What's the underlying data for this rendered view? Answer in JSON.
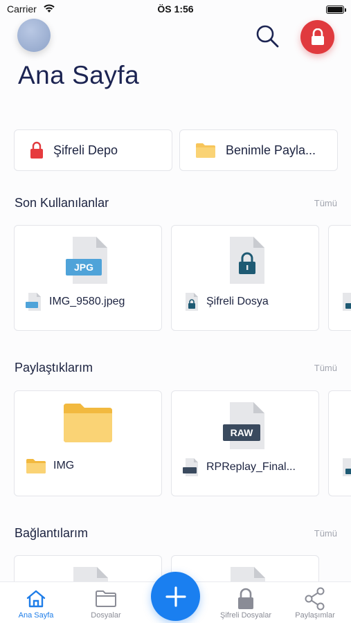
{
  "status_bar": {
    "carrier": "Carrier",
    "time": "ÖS 1:56"
  },
  "header": {
    "title": "Ana Sayfa"
  },
  "quick_access": [
    {
      "label": "Şifreli Depo",
      "icon": "red-lock-icon"
    },
    {
      "label": "Benimle Payla...",
      "icon": "yellow-folder-icon"
    }
  ],
  "sections": {
    "recent": {
      "title": "Son Kullanılanlar",
      "all_label": "Tümü",
      "items": [
        {
          "name": "IMG_9580.jpeg",
          "type_badge": "JPG",
          "icon": "jpg-file-icon"
        },
        {
          "name": "Şifreli Dosya",
          "icon": "locked-file-icon"
        }
      ]
    },
    "shared": {
      "title": "Paylaştıklarım",
      "all_label": "Tümü",
      "items": [
        {
          "name": "IMG",
          "icon": "folder-icon"
        },
        {
          "name": "RPReplay_Final...",
          "type_badge": "RAW",
          "icon": "raw-file-icon"
        }
      ]
    },
    "links": {
      "title": "Bağlantılarım",
      "all_label": "Tümü"
    }
  },
  "tab_bar": {
    "items": [
      {
        "label": "Ana Sayfa",
        "icon": "home-icon",
        "active": true
      },
      {
        "label": "Dosyalar",
        "icon": "folder-outline-icon",
        "active": false
      },
      {
        "label": "Şifreli Dosyalar",
        "icon": "lock-icon",
        "active": false
      },
      {
        "label": "Paylaşımlar",
        "icon": "share-icon",
        "active": false
      }
    ],
    "fab_icon": "plus-icon"
  },
  "colors": {
    "accent_blue": "#1a7ff0",
    "lock_red": "#e03a3e",
    "folder_yellow": "#f7c55a",
    "title_navy": "#1c2452"
  }
}
